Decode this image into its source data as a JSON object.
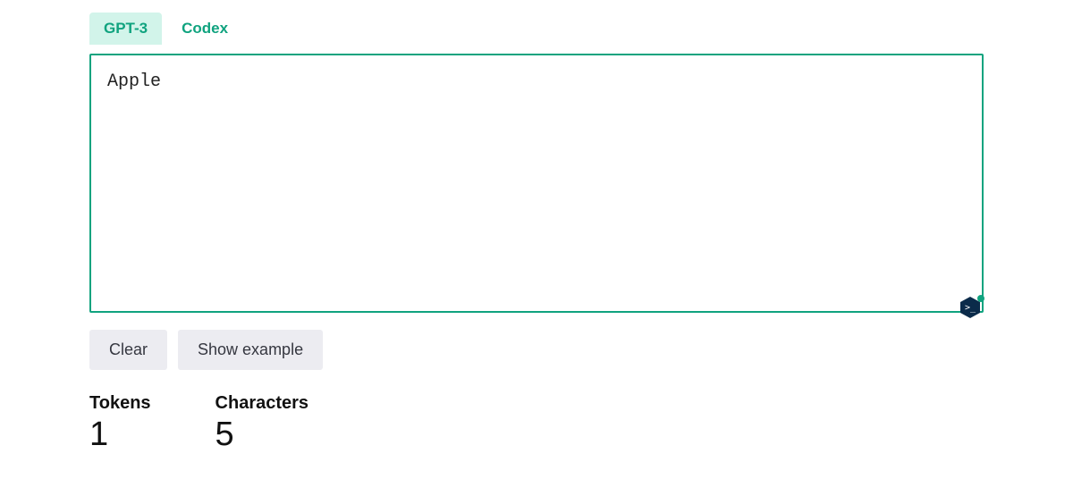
{
  "tabs": {
    "gpt3": "GPT-3",
    "codex": "Codex"
  },
  "input": {
    "value": "Apple"
  },
  "buttons": {
    "clear": "Clear",
    "show_example": "Show example"
  },
  "stats": {
    "tokens_label": "Tokens",
    "tokens_value": "1",
    "characters_label": "Characters",
    "characters_value": "5"
  },
  "icons": {
    "assistant": "assistant-icon"
  }
}
